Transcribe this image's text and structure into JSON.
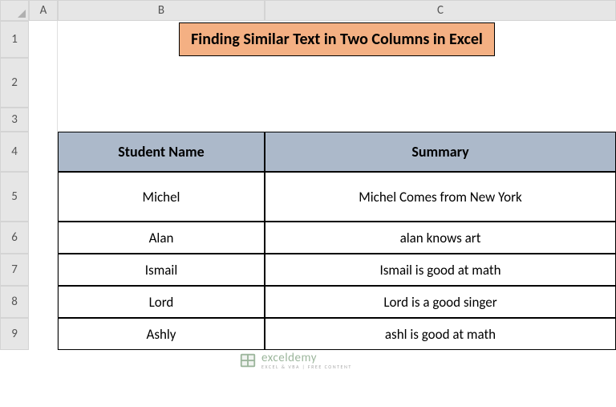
{
  "columns": {
    "a": "A",
    "b": "B",
    "c": "C"
  },
  "rows": {
    "r1": "1",
    "r2": "2",
    "r3": "3",
    "r4": "4",
    "r5": "5",
    "r6": "6",
    "r7": "7",
    "r8": "8",
    "r9": "9"
  },
  "title": "Finding Similar Text in Two Columns in Excel",
  "headers": {
    "name": "Student Name",
    "summary": "Summary"
  },
  "data": [
    {
      "name": "Michel",
      "summary": "Michel Comes from New York"
    },
    {
      "name": "Alan",
      "summary": "alan knows art"
    },
    {
      "name": "Ismail",
      "summary": "Ismail is good at math"
    },
    {
      "name": "Lord",
      "summary": "Lord is a good singer"
    },
    {
      "name": "Ashly",
      "summary": "ashl is good at math"
    }
  ],
  "watermark": {
    "brand": "exceldemy",
    "tagline": "EXCEL & VBA | FREE CONTENT"
  }
}
